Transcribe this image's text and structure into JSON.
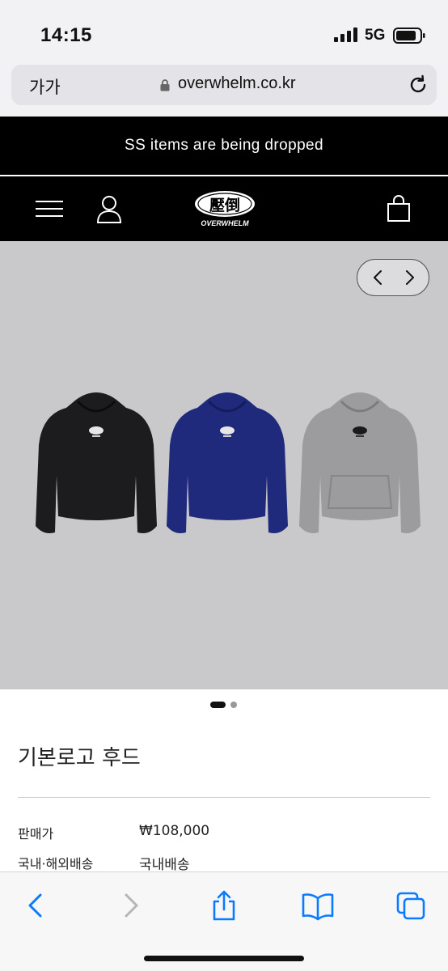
{
  "status_bar": {
    "time": "14:15",
    "network": "5G"
  },
  "browser": {
    "text_size_label": "가가",
    "url": "overwhelm.co.kr"
  },
  "announcement": {
    "text": "SS items are being dropped"
  },
  "header": {
    "brand_name": "OVERWHELM",
    "logo_mark": "壓倒"
  },
  "hero": {
    "slide_count": 2,
    "active_slide": 1,
    "hoodie_colors": [
      "#1c1c1e",
      "#1f2a7c",
      "#9c9c9e"
    ]
  },
  "product": {
    "title": "기본로고 후드",
    "price_label": "판매가",
    "price_value": "₩108,000",
    "shipping_label": "국내·해외배송",
    "shipping_value": "국내배송"
  },
  "colors": {
    "accent": "#0a7aff",
    "header_bg": "#000000",
    "hero_bg": "#c9c8cb"
  },
  "icons": {
    "menu": "hamburger-icon",
    "user": "user-icon",
    "cart": "shopping-bag-icon",
    "back": "chevron-left-icon",
    "forward": "chevron-right-icon",
    "share": "share-icon",
    "bookmarks": "book-icon",
    "tabs": "tabs-icon"
  }
}
